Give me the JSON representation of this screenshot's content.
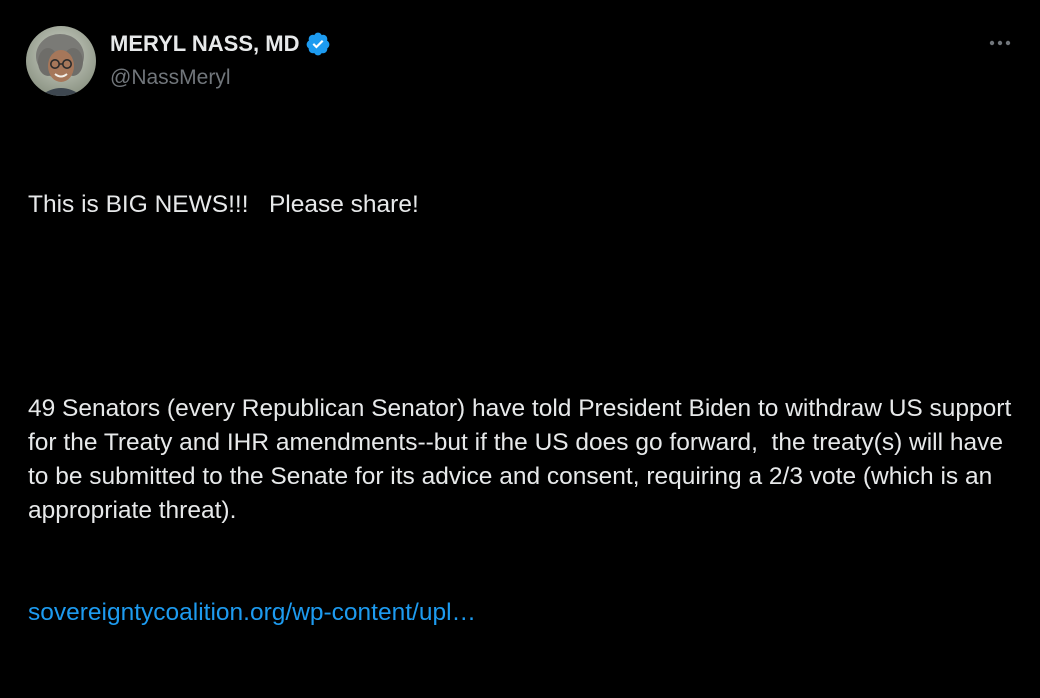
{
  "author": {
    "display_name": "MERYL NASS, MD",
    "handle": "@NassMeryl",
    "verified": true
  },
  "icons": {
    "verified": "verified-badge-icon",
    "more": "more-options-icon",
    "avatar": "profile-photo"
  },
  "tweet": {
    "line1": "This is BIG NEWS!!!   Please share!",
    "line2": "49 Senators (every Republican Senator) have told President Biden to withdraw US support for the Treaty and IHR amendments--but if the US does go forward,  the treaty(s) will have to be submitted to the Senate for its advice and consent, requiring a 2/3 vote (which is an appropriate threat).",
    "link_text": "sovereigntycoalition.org/wp-content/upl…"
  },
  "colors": {
    "background": "#000000",
    "text": "#e7e9ea",
    "secondary": "#71767b",
    "link": "#1d9bf0",
    "verified": "#1d9bf0"
  }
}
